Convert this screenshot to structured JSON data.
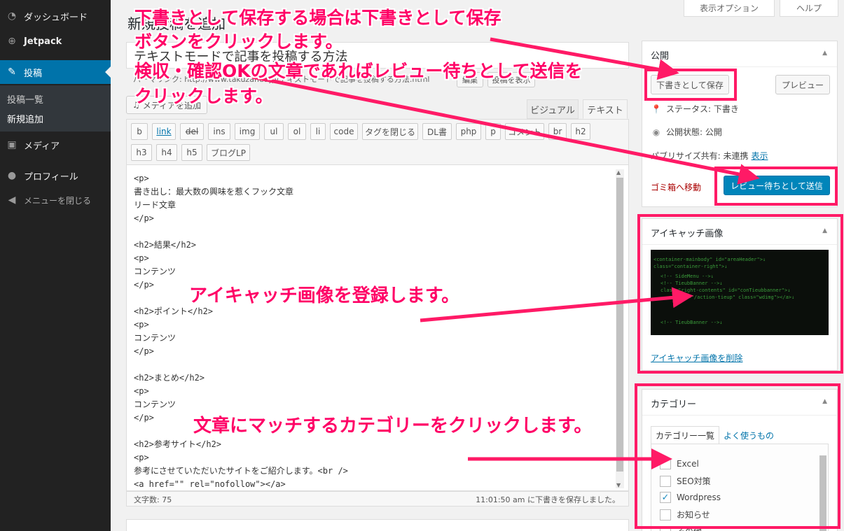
{
  "sidebar": {
    "items": [
      {
        "label": "ダッシュボード",
        "icon": "dashboard-icon"
      },
      {
        "label": "Jetpack",
        "icon": "jetpack-icon"
      },
      {
        "label": "投稿",
        "icon": "pin-icon"
      },
      {
        "label": "メディア",
        "icon": "media-icon"
      },
      {
        "label": "プロフィール",
        "icon": "user-icon"
      },
      {
        "label": "メニューを閉じる",
        "icon": "collapse-icon"
      }
    ],
    "submenu": [
      "投稿一覧",
      "新規追加"
    ]
  },
  "top": {
    "screen_options": "表示オプション",
    "help": "ヘルプ"
  },
  "page_title": "新規投稿を追加",
  "title_value": "テキストモードで記事を投稿する方法",
  "permalink": {
    "text": "パーマリンク: http://www.takuzanet.jp/テキストモードで記事を投稿する方法.html",
    "edit": "編集",
    "view": "投稿を表示"
  },
  "editor": {
    "add_media": "メディアを追加",
    "tab_visual": "ビジュアル",
    "tab_text": "テキスト",
    "quicktags": [
      "b",
      "link",
      "del",
      "ins",
      "img",
      "ul",
      "ol",
      "li",
      "code",
      "タグを閉じる",
      "DL書",
      "php",
      "p",
      "コメント",
      "br",
      "h2",
      "h3",
      "h4",
      "h5",
      "ブログLP"
    ],
    "content": "<p>\n書き出し：最大数の興味を惹くフック文章\nリード文章\n</p>\n\n<h2>結果</h2>\n<p>\nコンテンツ\n</p>\n\n<h2>ポイント</h2>\n<p>\nコンテンツ\n</p>\n\n<h2>まとめ</h2>\n<p>\nコンテンツ\n</p>\n\n<h2>参考サイト</h2>\n<p>\n参考にさせていただいたサイトをご紹介します。<br />\n<a href=\"\" rel=\"nofollow\"></a>",
    "word_count": "文字数: 75",
    "autosave": "11:01:50 am に下書きを保存しました。"
  },
  "publish": {
    "title": "公開",
    "save_draft": "下書きとして保存",
    "preview": "プレビュー",
    "status": "ステータス: 下書き",
    "visibility": "公開状態: 公開",
    "publicize_label": "パブリサイズ共有: 未連携",
    "publicize_link": "表示",
    "trash": "ゴミ箱へ移動",
    "submit_review": "レビュー待ちとして送信"
  },
  "featured": {
    "title": "アイキャッチ画像",
    "remove": "アイキャッチ画像を削除",
    "code_lines": [
      "<container-mainbody\" id=\"areaHeader\">↓",
      "class=\"container-right\">↓",
      "<!-- SideMenu -->↓",
      "<!-- TieubBanner -->↓",
      "class=\"right-contents\" id=\"conTieubbanner\">↓",
      "<a href=\"/action-tieup\" class=\"wdimg\"></a>↓",
      "<!-- TieubBanner -->↓"
    ]
  },
  "categories": {
    "title": "カテゴリー",
    "tab_all": "カテゴリー一覧",
    "tab_popular": "よく使うもの",
    "items": [
      {
        "label": "Excel",
        "checked": false
      },
      {
        "label": "SEO対策",
        "checked": false
      },
      {
        "label": "Wordpress",
        "checked": true
      },
      {
        "label": "お知らせ",
        "checked": false
      },
      {
        "label": "その他",
        "checked": false
      }
    ]
  },
  "annotations": {
    "draft_line1": "下書きとして保存する場合は下書きとして保存",
    "draft_line2": "ボタンをクリックします。",
    "review_line1": "検収・確認OKの文章であればレビュー待ちとして送信を",
    "review_line2": "クリックします。",
    "featured": "アイキャッチ画像を登録します。",
    "category": "文章にマッチするカテゴリーをクリックします。"
  },
  "colors": {
    "accent": "#0073aa",
    "annotation": "#ff0066",
    "primary_button": "#0085ba"
  }
}
